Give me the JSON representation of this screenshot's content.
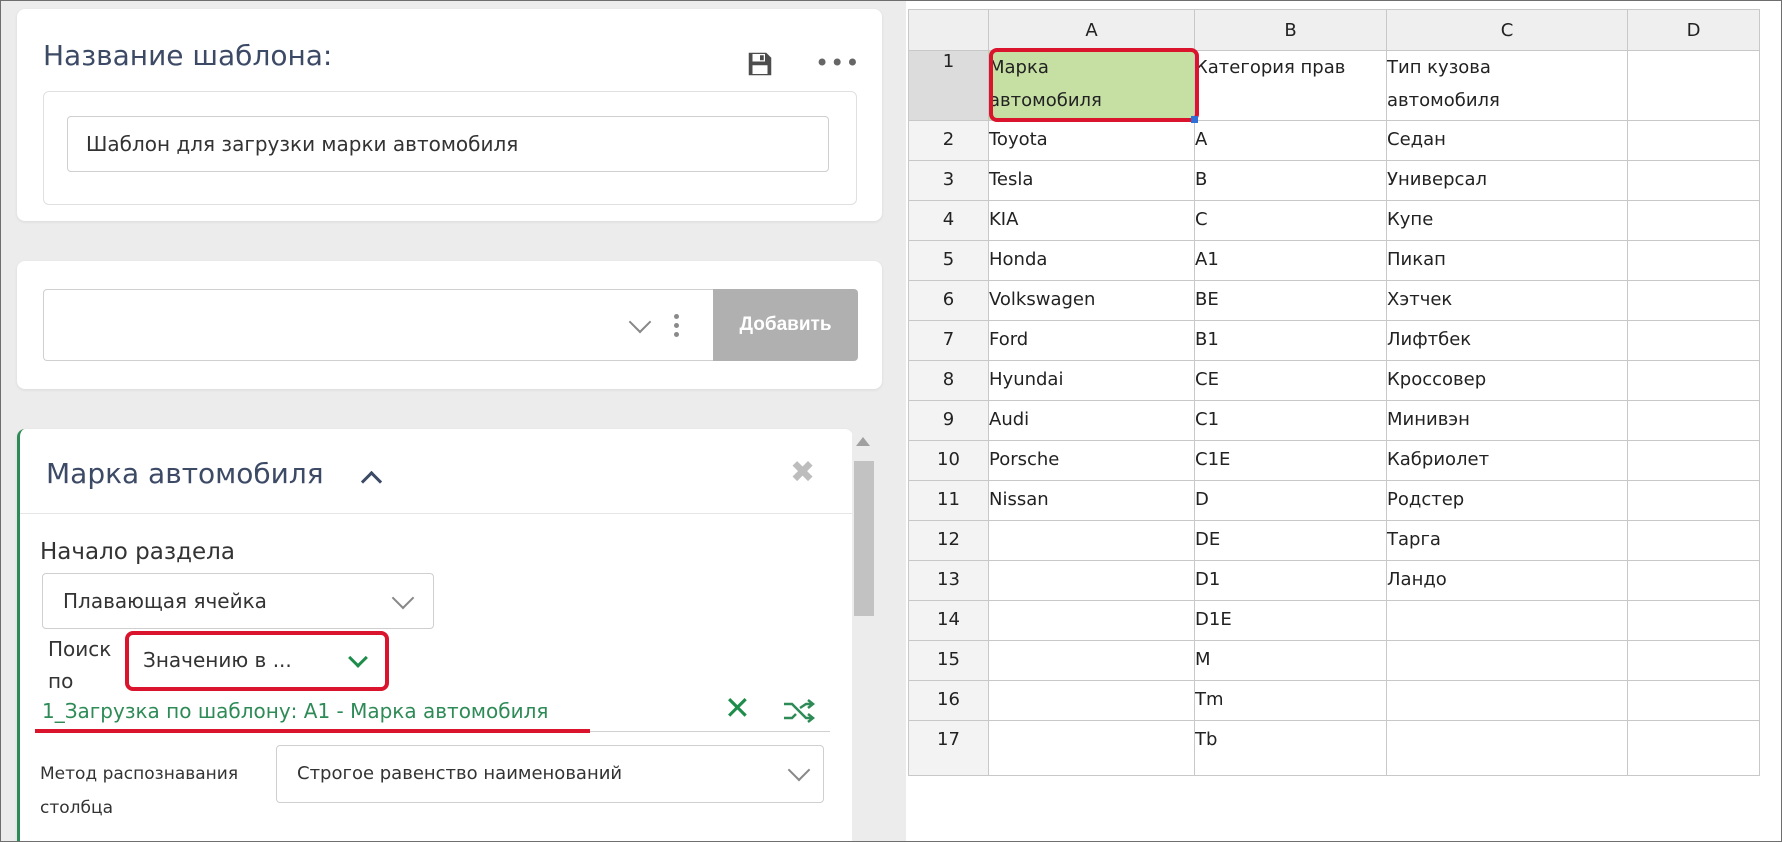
{
  "template": {
    "title": "Название шаблона:",
    "name_value": "Шаблон для загрузки марки автомобиля"
  },
  "add_row": {
    "select_value": "",
    "add_label": "Добавить"
  },
  "section": {
    "title": "Марка автомобиля",
    "start_label": "Начало раздела",
    "start_value": "Плавающая ячейка",
    "search_label": "Поиск по",
    "search_value": "Значению в ...",
    "link_text": "1_Загрузка по шаблону: A1 - Марка автомобиля",
    "method_label": "Метод распознавания столбца",
    "method_value": "Строгое равенство наименований"
  },
  "sheet": {
    "columns": [
      "A",
      "B",
      "C",
      "D"
    ],
    "rows": [
      {
        "n": "1",
        "a": "Марка автомобиля",
        "b": "Категория прав",
        "c": "Тип кузова автомобиля",
        "d": ""
      },
      {
        "n": "2",
        "a": "Toyota",
        "b": "A",
        "c": "Седан",
        "d": ""
      },
      {
        "n": "3",
        "a": "Tesla",
        "b": "B",
        "c": "Универсал",
        "d": ""
      },
      {
        "n": "4",
        "a": "KIA",
        "b": "C",
        "c": "Купе",
        "d": ""
      },
      {
        "n": "5",
        "a": "Honda",
        "b": "A1",
        "c": "Пикап",
        "d": ""
      },
      {
        "n": "6",
        "a": "Volkswagen",
        "b": "BE",
        "c": "Хэтчек",
        "d": ""
      },
      {
        "n": "7",
        "a": "Ford",
        "b": "B1",
        "c": "Лифтбек",
        "d": ""
      },
      {
        "n": "8",
        "a": "Hyundai",
        "b": "CE",
        "c": "Кроссовер",
        "d": ""
      },
      {
        "n": "9",
        "a": "Audi",
        "b": "C1",
        "c": "Минивэн",
        "d": ""
      },
      {
        "n": "10",
        "a": "Porsche",
        "b": "C1E",
        "c": "Кабриолет",
        "d": ""
      },
      {
        "n": "11",
        "a": "Nissan",
        "b": "D",
        "c": "Родстер",
        "d": ""
      },
      {
        "n": "12",
        "a": "",
        "b": "DE",
        "c": "Тарга",
        "d": ""
      },
      {
        "n": "13",
        "a": "",
        "b": "D1",
        "c": "Ландо",
        "d": ""
      },
      {
        "n": "14",
        "a": "",
        "b": "D1E",
        "c": "",
        "d": ""
      },
      {
        "n": "15",
        "a": "",
        "b": "M",
        "c": "",
        "d": ""
      },
      {
        "n": "16",
        "a": "",
        "b": "Tm",
        "c": "",
        "d": ""
      },
      {
        "n": "17",
        "a": "",
        "b": "Tb",
        "c": "",
        "d": ""
      }
    ]
  },
  "colors": {
    "accent_green": "#2e8b57",
    "highlight_red": "#d9142c",
    "selected_cell": "#c6e0a4",
    "title_color": "#3d4a66"
  },
  "icons": [
    "save-icon",
    "more-icon",
    "chevron-down-icon",
    "kebab-icon",
    "chevron-up-icon",
    "close-icon",
    "clear-icon",
    "shuffle-icon"
  ]
}
